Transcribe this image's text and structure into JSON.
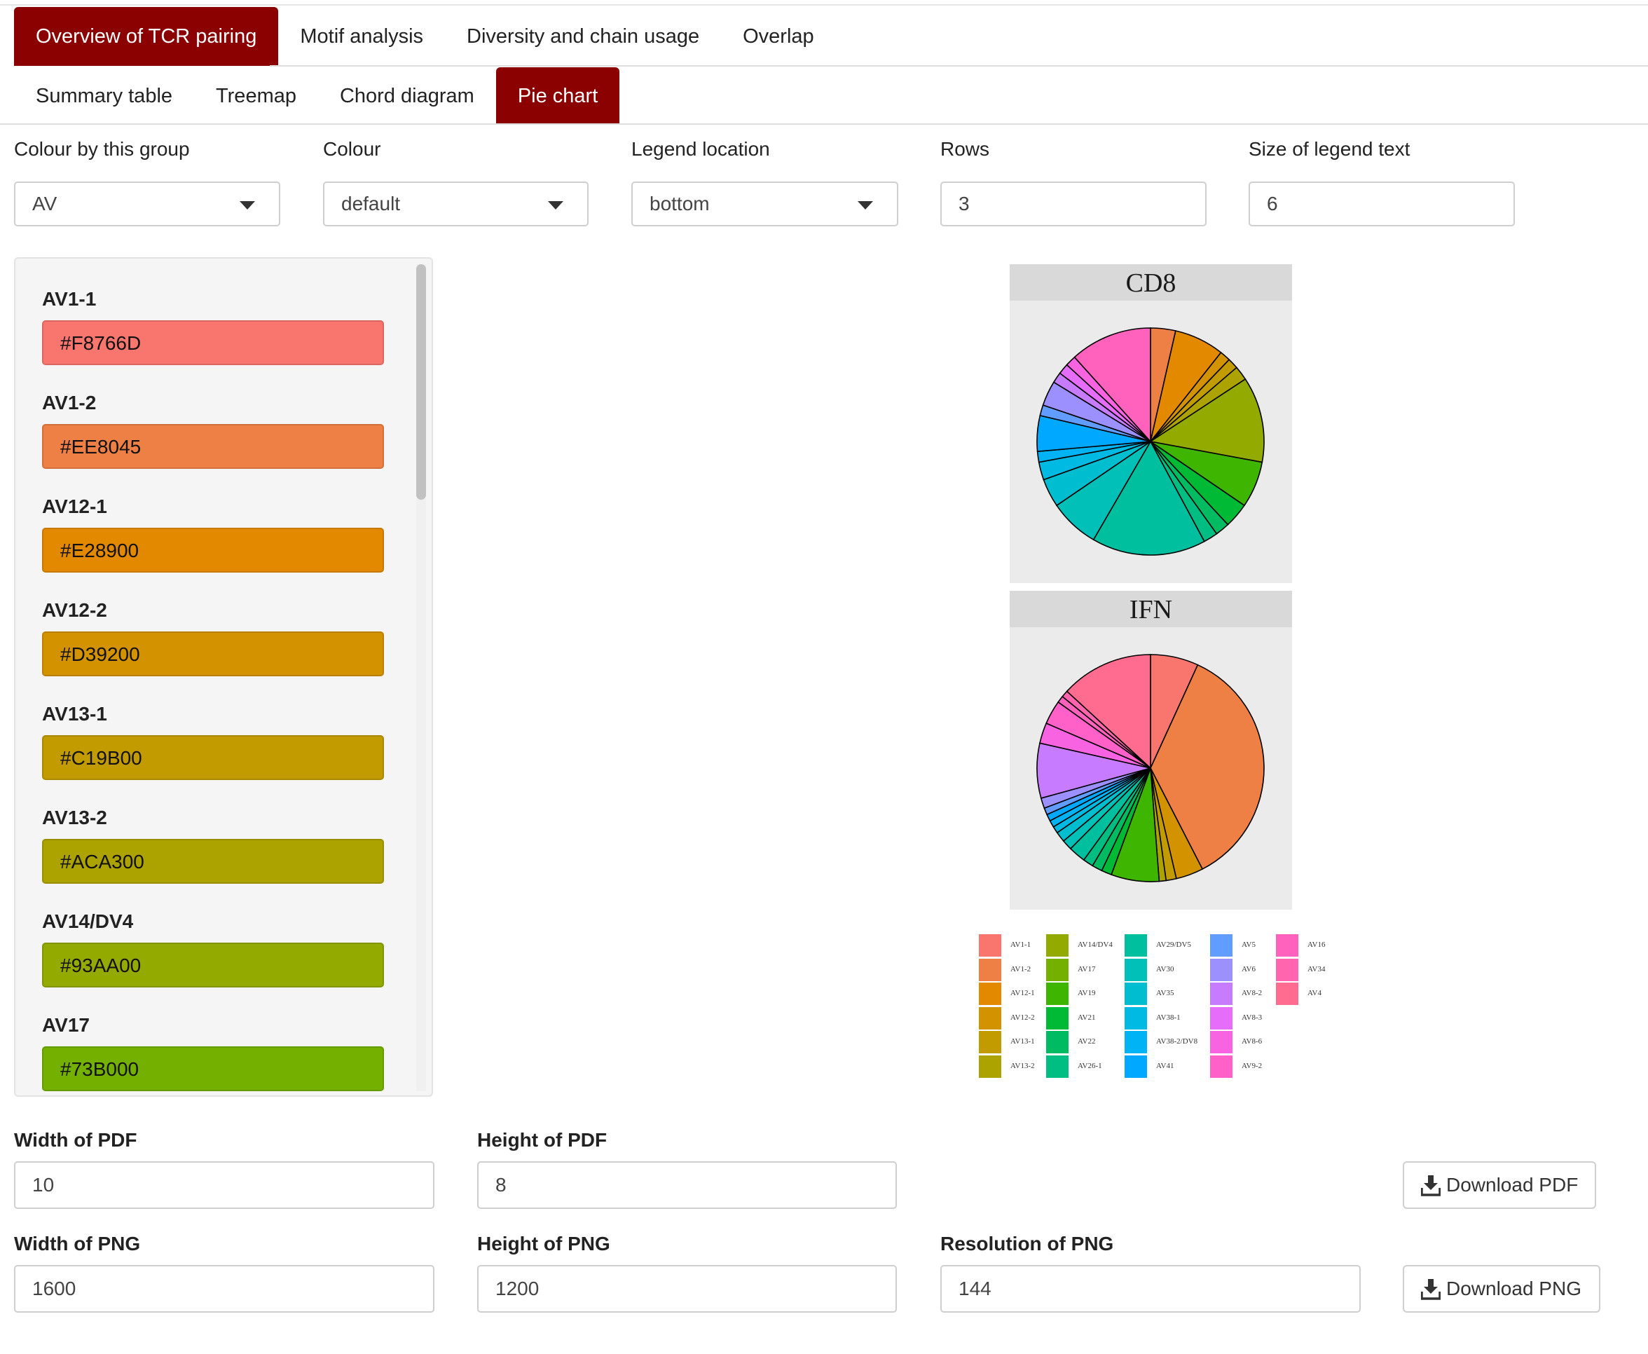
{
  "main_tabs": [
    "Overview of TCR pairing",
    "Motif analysis",
    "Diversity and chain usage",
    "Overlap"
  ],
  "sub_tabs": [
    "Summary table",
    "Treemap",
    "Chord diagram",
    "Pie chart"
  ],
  "controls": {
    "colour_group": {
      "label": "Colour by this group",
      "value": "AV"
    },
    "colour": {
      "label": "Colour",
      "value": "default"
    },
    "legend_location": {
      "label": "Legend location",
      "value": "bottom"
    },
    "rows": {
      "label": "Rows",
      "value": "3"
    },
    "legend_size": {
      "label": "Size of legend text",
      "value": "6"
    }
  },
  "colour_items": [
    {
      "label": "AV1-1",
      "color": "#F8766D"
    },
    {
      "label": "AV1-2",
      "color": "#EE8045"
    },
    {
      "label": "AV12-1",
      "color": "#E28900"
    },
    {
      "label": "AV12-2",
      "color": "#D39200"
    },
    {
      "label": "AV13-1",
      "color": "#C19B00"
    },
    {
      "label": "AV13-2",
      "color": "#ACA300"
    },
    {
      "label": "AV14/DV4",
      "color": "#93AA00"
    },
    {
      "label": "AV17",
      "color": "#73B000"
    }
  ],
  "chart_data": [
    {
      "type": "pie",
      "title": "CD8",
      "slices": [
        {
          "category": "AV1-1",
          "value": 0.0
        },
        {
          "category": "AV1-2",
          "value": 3.5
        },
        {
          "category": "AV12-1",
          "value": 7.0
        },
        {
          "category": "AV12-2",
          "value": 1.5
        },
        {
          "category": "AV13-1",
          "value": 1.5
        },
        {
          "category": "AV13-2",
          "value": 2.0
        },
        {
          "category": "AV14/DV4",
          "value": 12.0
        },
        {
          "category": "AV17",
          "value": 0.0
        },
        {
          "category": "AV19",
          "value": 6.5
        },
        {
          "category": "AV21",
          "value": 3.5
        },
        {
          "category": "AV22",
          "value": 2.0
        },
        {
          "category": "AV26-1",
          "value": 2.0
        },
        {
          "category": "AV29/DV5",
          "value": 16.0
        },
        {
          "category": "AV30",
          "value": 7.0
        },
        {
          "category": "AV35",
          "value": 4.0
        },
        {
          "category": "AV38-1",
          "value": 2.5
        },
        {
          "category": "AV38-2/DV8",
          "value": 1.5
        },
        {
          "category": "AV41",
          "value": 5.0
        },
        {
          "category": "AV5",
          "value": 1.5
        },
        {
          "category": "AV6",
          "value": 3.5
        },
        {
          "category": "AV8-2",
          "value": 1.5
        },
        {
          "category": "AV8-3",
          "value": 1.5
        },
        {
          "category": "AV8-6",
          "value": 1.5
        },
        {
          "category": "AV9-2",
          "value": 0.0
        },
        {
          "category": "AV16",
          "value": 11.5
        },
        {
          "category": "AV34",
          "value": 0.0
        },
        {
          "category": "AV4",
          "value": 0.0
        }
      ]
    },
    {
      "type": "pie",
      "title": "IFN",
      "slices": [
        {
          "category": "AV1-1",
          "value": 7.0
        },
        {
          "category": "AV1-2",
          "value": 36.5
        },
        {
          "category": "AV12-1",
          "value": 0.0
        },
        {
          "category": "AV12-2",
          "value": 4.0
        },
        {
          "category": "AV13-1",
          "value": 1.5
        },
        {
          "category": "AV13-2",
          "value": 1.0
        },
        {
          "category": "AV14/DV4",
          "value": 0.0
        },
        {
          "category": "AV17",
          "value": 0.0
        },
        {
          "category": "AV19",
          "value": 7.0
        },
        {
          "category": "AV21",
          "value": 1.5
        },
        {
          "category": "AV22",
          "value": 1.5
        },
        {
          "category": "AV26-1",
          "value": 1.5
        },
        {
          "category": "AV29/DV5",
          "value": 2.5
        },
        {
          "category": "AV30",
          "value": 1.5
        },
        {
          "category": "AV35",
          "value": 1.5
        },
        {
          "category": "AV38-1",
          "value": 1.0
        },
        {
          "category": "AV38-2/DV8",
          "value": 1.0
        },
        {
          "category": "AV41",
          "value": 1.0
        },
        {
          "category": "AV5",
          "value": 1.0
        },
        {
          "category": "AV6",
          "value": 1.5
        },
        {
          "category": "AV8-2",
          "value": 8.0
        },
        {
          "category": "AV8-3",
          "value": 0.0
        },
        {
          "category": "AV8-6",
          "value": 3.0
        },
        {
          "category": "AV9-2",
          "value": 3.5
        },
        {
          "category": "AV16",
          "value": 1.0
        },
        {
          "category": "AV34",
          "value": 1.0
        },
        {
          "category": "AV4",
          "value": 13.5
        }
      ]
    }
  ],
  "legend": {
    "items": [
      {
        "label": "AV1-1",
        "color": "#F8766D"
      },
      {
        "label": "AV1-2",
        "color": "#EE8045"
      },
      {
        "label": "AV12-1",
        "color": "#E28900"
      },
      {
        "label": "AV12-2",
        "color": "#D39200"
      },
      {
        "label": "AV13-1",
        "color": "#C19B00"
      },
      {
        "label": "AV13-2",
        "color": "#ACA300"
      },
      {
        "label": "AV14/DV4",
        "color": "#93AA00"
      },
      {
        "label": "AV17",
        "color": "#73B000"
      },
      {
        "label": "AV19",
        "color": "#3EB500"
      },
      {
        "label": "AV21",
        "color": "#00B934"
      },
      {
        "label": "AV22",
        "color": "#00BB62"
      },
      {
        "label": "AV26-1",
        "color": "#00BD82"
      },
      {
        "label": "AV29/DV5",
        "color": "#00BF9F"
      },
      {
        "label": "AV30",
        "color": "#00C0B8"
      },
      {
        "label": "AV35",
        "color": "#00BECF"
      },
      {
        "label": "AV38-1",
        "color": "#00BAE3"
      },
      {
        "label": "AV38-2/DV8",
        "color": "#00B3F4"
      },
      {
        "label": "AV41",
        "color": "#00A9FF"
      },
      {
        "label": "AV5",
        "color": "#619CFF"
      },
      {
        "label": "AV6",
        "color": "#9C8FFF"
      },
      {
        "label": "AV8-2",
        "color": "#C77CFF"
      },
      {
        "label": "AV8-3",
        "color": "#E66DF9"
      },
      {
        "label": "AV8-6",
        "color": "#F763E0"
      },
      {
        "label": "AV9-2",
        "color": "#FF61C9"
      },
      {
        "label": "AV16",
        "color": "#FF62BC"
      },
      {
        "label": "AV34",
        "color": "#FF65AE"
      },
      {
        "label": "AV4",
        "color": "#FF6C90"
      }
    ]
  },
  "pdf": {
    "width_label": "Width of PDF",
    "width_value": "10",
    "height_label": "Height of PDF",
    "height_value": "8",
    "download_label": "Download PDF"
  },
  "png": {
    "width_label": "Width of PNG",
    "width_value": "1600",
    "height_label": "Height of PNG",
    "height_value": "1200",
    "res_label": "Resolution of PNG",
    "res_value": "144",
    "download_label": "Download PNG"
  },
  "colors": {
    "accent": "#8B0000"
  }
}
